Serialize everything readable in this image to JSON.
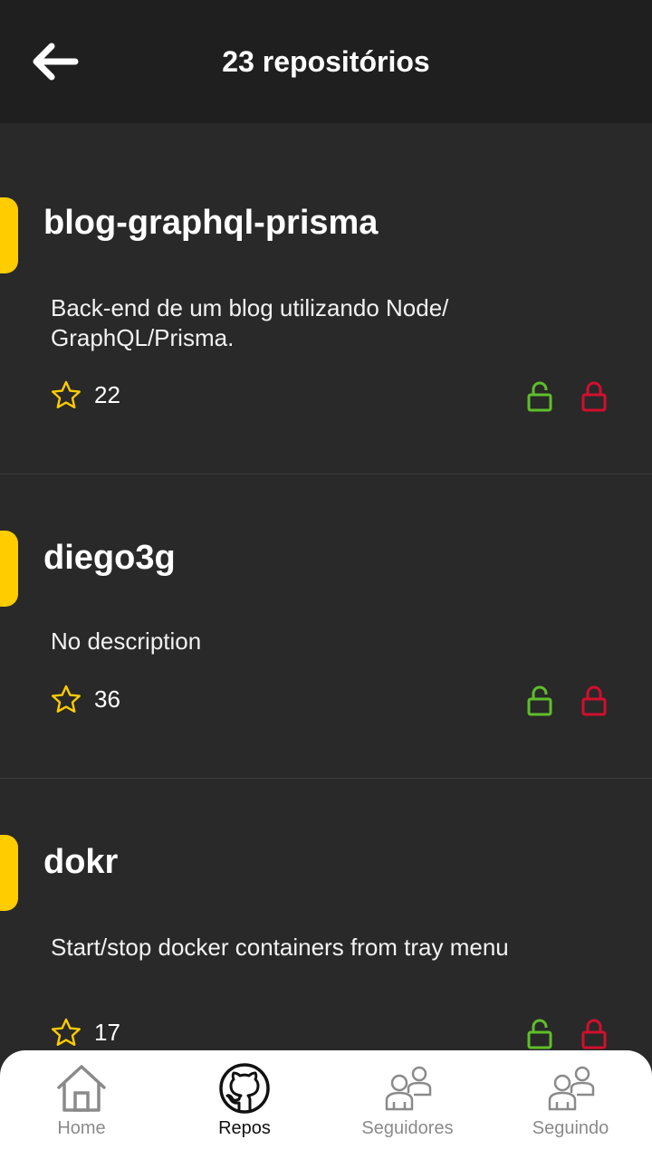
{
  "header": {
    "title": "23 repositórios"
  },
  "repos": [
    {
      "name": "blog-graphql-prisma",
      "description": "Back-end de um blog utilizando Node/ GraphQL/Prisma.",
      "stars": "22"
    },
    {
      "name": "diego3g",
      "description": "No description",
      "stars": "36"
    },
    {
      "name": "dokr",
      "description": "Start/stop docker containers from tray menu",
      "stars": "17"
    }
  ],
  "tabs": [
    {
      "label": "Home",
      "icon": "home-icon"
    },
    {
      "label": "Repos",
      "icon": "github-icon"
    },
    {
      "label": "Seguidores",
      "icon": "followers-icon"
    },
    {
      "label": "Seguindo",
      "icon": "following-icon"
    }
  ],
  "colors": {
    "background": "#292929",
    "header": "#1f1f1f",
    "accent": "#ffcc00",
    "unlock": "#5fbf2a",
    "lock": "#d0102e",
    "tabbar": "#ffffff"
  }
}
